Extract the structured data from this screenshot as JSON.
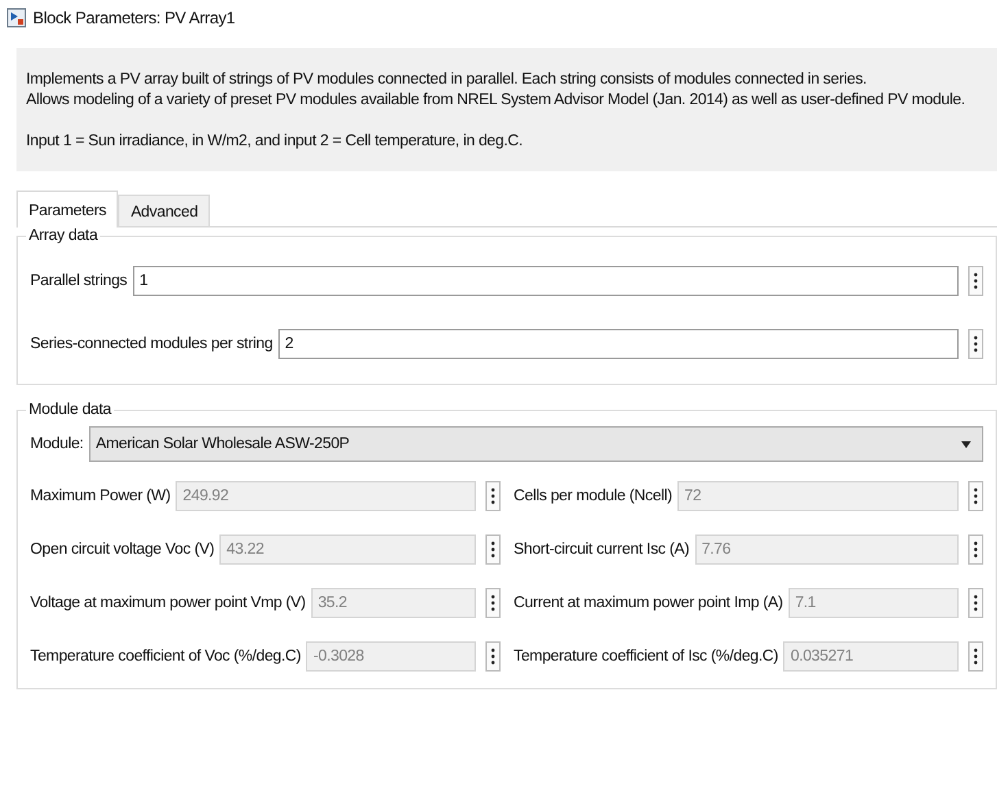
{
  "window": {
    "title": "Block Parameters: PV Array1"
  },
  "description": {
    "lines": [
      "Implements a PV array built of strings of PV modules connected in parallel. Each string consists of modules connected in series.",
      "Allows modeling of a variety of preset PV modules available from NREL System Advisor Model (Jan. 2014) as well as user-defined PV module."
    ],
    "input_note": "Input 1 = Sun irradiance, in W/m2, and input 2 = Cell temperature, in deg.C."
  },
  "tabs": [
    {
      "label": "Parameters",
      "selected": true
    },
    {
      "label": "Advanced",
      "selected": false
    }
  ],
  "array_data": {
    "title": "Array data",
    "fields": [
      {
        "label": "Parallel strings",
        "value": "1",
        "disabled": false
      },
      {
        "label": "Series-connected modules per string",
        "value": "2",
        "disabled": false
      }
    ]
  },
  "module_data": {
    "title": "Module data",
    "module": {
      "label": "Module:",
      "value": "American Solar Wholesale ASW-250P"
    },
    "fields": [
      {
        "label": "Maximum Power (W)",
        "value": "249.92",
        "disabled": true
      },
      {
        "label": "Cells per module (Ncell)",
        "value": "72",
        "disabled": true
      },
      {
        "label": "Open circuit voltage  Voc (V)",
        "value": "43.22",
        "disabled": true
      },
      {
        "label": "Short-circuit current Isc (A)",
        "value": "7.76",
        "disabled": true
      },
      {
        "label": "Voltage at maximum power point Vmp (V)",
        "value": "35.2",
        "disabled": true
      },
      {
        "label": "Current at maximum power point Imp (A)",
        "value": "7.1",
        "disabled": true
      },
      {
        "label": "Temperature coefficient of Voc (%/deg.C)",
        "value": "-0.3028",
        "disabled": true
      },
      {
        "label": "Temperature coefficient of Isc (%/deg.C)",
        "value": "0.035271",
        "disabled": true
      }
    ]
  }
}
